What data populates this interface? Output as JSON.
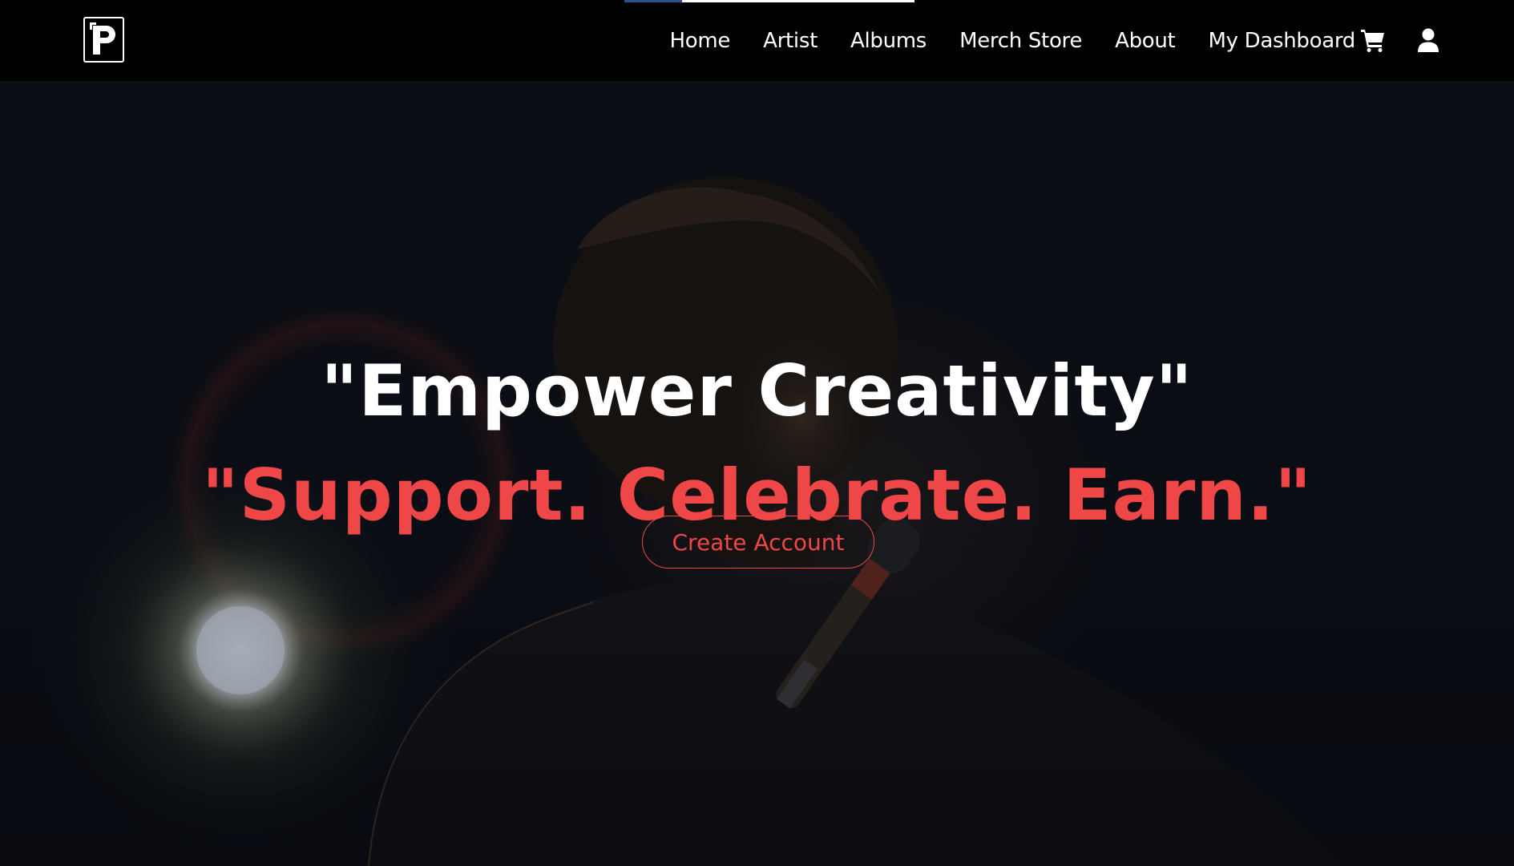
{
  "nav": {
    "logo_letter": "P",
    "links": [
      "Home",
      "Artist",
      "Albums",
      "Merch Store",
      "About",
      "My Dashboard"
    ],
    "cart_icon": "shopping-cart-icon",
    "user_icon": "user-icon",
    "loading_progress": 0.2
  },
  "hero": {
    "headline": "\"Empower Creativity\"",
    "subheadline": "\"Support. Celebrate. Earn.\"",
    "cta_label": "Create Account",
    "background": "concert-singer-photo"
  },
  "colors": {
    "accent": "#ef4747",
    "nav_bg": "#000000",
    "hero_bg": "#0b0e14",
    "text": "#ffffff"
  }
}
